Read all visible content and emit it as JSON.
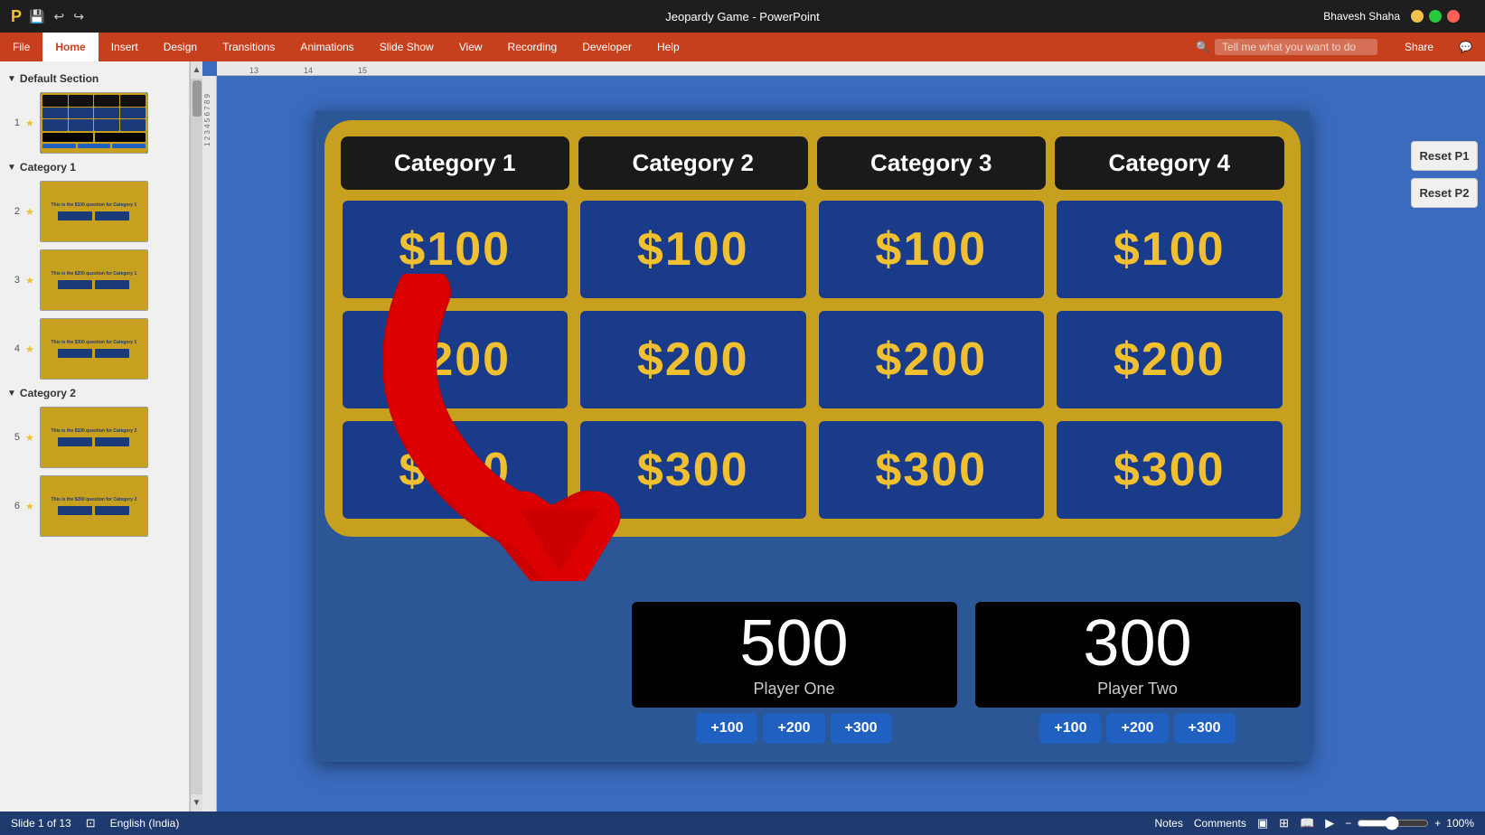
{
  "titlebar": {
    "title": "Jeopardy Game - PowerPoint",
    "user": "Bhavesh Shaha"
  },
  "ribbon": {
    "tabs": [
      "File",
      "Home",
      "Insert",
      "Design",
      "Transitions",
      "Animations",
      "Slide Show",
      "View",
      "Recording",
      "Developer",
      "Help"
    ],
    "active_tab": "Home",
    "search_placeholder": "Tell me what you want to do",
    "share_label": "Share"
  },
  "sidebar": {
    "sections": [
      {
        "name": "Default Section",
        "slides": [
          {
            "num": "1",
            "star": "★"
          }
        ]
      },
      {
        "name": "Category 1",
        "slides": [
          {
            "num": "2",
            "star": "★"
          },
          {
            "num": "3",
            "star": "★"
          },
          {
            "num": "4",
            "star": "★"
          }
        ]
      },
      {
        "name": "Category 2",
        "slides": [
          {
            "num": "5",
            "star": "★"
          },
          {
            "num": "6",
            "star": "★"
          }
        ]
      }
    ]
  },
  "jeopardy": {
    "categories": [
      "Category 1",
      "Category 2",
      "Category 3",
      "Category 4"
    ],
    "prices": [
      "$100",
      "$200",
      "$300"
    ]
  },
  "players": [
    {
      "name": "Player One",
      "score": "500",
      "buttons": [
        "+100",
        "+200",
        "+300"
      ]
    },
    {
      "name": "Player Two",
      "score": "300",
      "buttons": [
        "+100",
        "+200",
        "+300"
      ]
    }
  ],
  "right_panel": {
    "reset_p1": "Reset P1",
    "reset_p2": "Reset P2"
  },
  "statusbar": {
    "slide_info": "Slide 1 of 13",
    "language": "English (India)",
    "notes_label": "Notes",
    "comments_label": "Comments",
    "zoom_level": "100%"
  }
}
